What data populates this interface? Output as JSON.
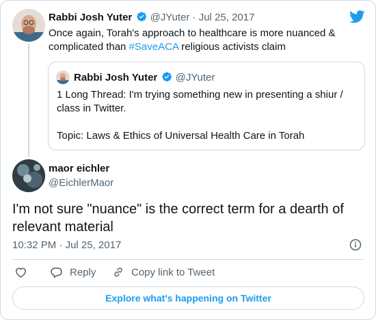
{
  "parent_tweet": {
    "author_name": "Rabbi Josh Yuter",
    "handle": "@JYuter",
    "separator": "·",
    "date": "Jul 25, 2017",
    "text_before": "Once again, Torah's approach to healthcare is more nuanced & complicated than ",
    "hashtag": "#SaveACA",
    "text_after": " religious activists claim"
  },
  "quoted_tweet": {
    "author_name": "Rabbi Josh Yuter",
    "handle": "@JYuter",
    "paragraphs": [
      "1 Long Thread: I'm trying something new in presenting a shiur / class in Twitter.",
      "Topic: Laws & Ethics of Universal Health Care in Torah"
    ]
  },
  "main_tweet": {
    "author_name": "maor eichler",
    "handle": "@EichlerMaor",
    "text": "I'm not sure \"nuance\" is the correct term for a dearth of relevant material",
    "time": "10:32 PM",
    "separator": "·",
    "date": "Jul 25, 2017"
  },
  "actions": {
    "reply_label": "Reply",
    "copy_link_label": "Copy link to Tweet"
  },
  "explore_label": "Explore what's happening on Twitter",
  "icons": {
    "brand": "twitter-bird-icon",
    "verified": "verified-badge-icon",
    "like": "heart-icon",
    "reply": "reply-bubble-icon",
    "copy": "link-icon",
    "info": "info-icon"
  },
  "colors": {
    "accent": "#1d9bf0",
    "text": "#0f1419",
    "muted": "#536471",
    "border": "#cfd9de"
  }
}
